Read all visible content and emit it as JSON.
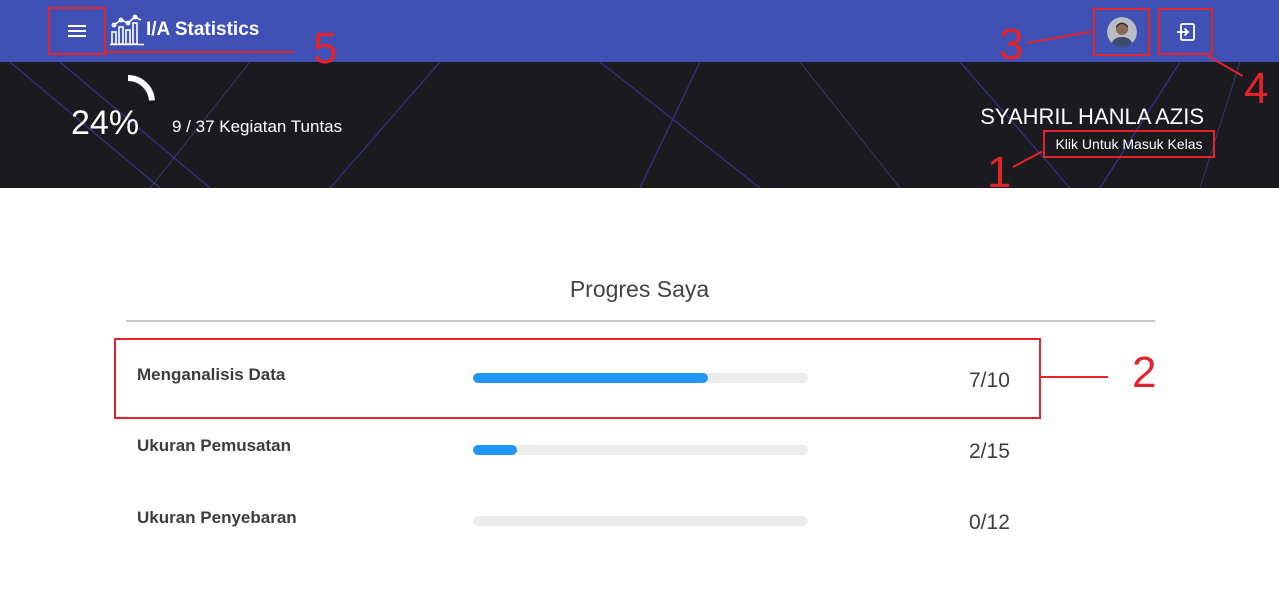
{
  "app": {
    "title": "I/A Statistics",
    "icons": {
      "menu": "hamburger-menu-icon",
      "brand": "bar-chart-icon",
      "logout": "sign-in-icon"
    }
  },
  "progress": {
    "percent_label": "24%",
    "percent": 24,
    "tasks_label": "9 / 37 Kegiatan Tuntas"
  },
  "user": {
    "name": "SYAHRIL HANLA AZIS",
    "enter_class_label": "Klik Untuk Masuk Kelas"
  },
  "main": {
    "section_title": "Progres Saya",
    "items": [
      {
        "label": "Menganalisis Data",
        "count_label": "7/10",
        "progress": 0.7
      },
      {
        "label": "Ukuran Pemusatan",
        "count_label": "2/15",
        "progress": 0.13
      },
      {
        "label": "Ukuran Penyebaran",
        "count_label": "0/12",
        "progress": 0.0
      }
    ]
  },
  "annotations": [
    "1",
    "2",
    "3",
    "4",
    "5"
  ],
  "colors": {
    "topbar": "#3f51b5",
    "hero": "#1b1b1f",
    "bar_fill": "#2196f3",
    "bar_track": "#ececec",
    "annotation": "#e3252b"
  }
}
